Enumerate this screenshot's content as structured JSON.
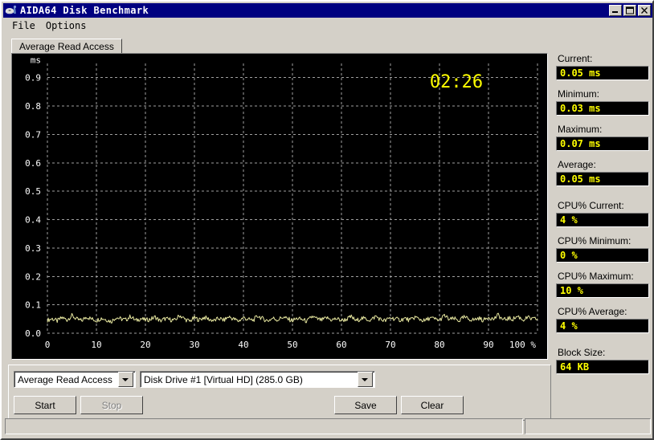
{
  "window": {
    "title": "AIDA64 Disk Benchmark",
    "icon": "disk-icon",
    "buttons": {
      "minimize": "minimize-icon",
      "maximize": "maximize-icon",
      "close": "close-icon"
    }
  },
  "menu": {
    "items": [
      {
        "label": "File"
      },
      {
        "label": "Options"
      }
    ]
  },
  "tab": {
    "label": "Average Read Access"
  },
  "chart_data": {
    "type": "line",
    "title": "",
    "timer": "02:26",
    "xlabel": "%",
    "ylabel": "ms",
    "xlim": [
      0,
      100
    ],
    "ylim": [
      0.0,
      0.95
    ],
    "grid": true,
    "legend": "none",
    "background": "#000000",
    "line_color": "#e8e8a0",
    "grid_color": "#a0a0a0",
    "axis_text_color": "#ffffff",
    "timer_color": "#ffff00",
    "x_ticks": [
      "0",
      "10",
      "20",
      "30",
      "40",
      "50",
      "60",
      "70",
      "80",
      "90",
      "100 %"
    ],
    "x_tick_values": [
      0,
      10,
      20,
      30,
      40,
      50,
      60,
      70,
      80,
      90,
      100
    ],
    "y_ticks": [
      "0.0",
      "0.1",
      "0.2",
      "0.3",
      "0.4",
      "0.5",
      "0.6",
      "0.7",
      "0.8",
      "0.9"
    ],
    "y_tick_values": [
      0.0,
      0.1,
      0.2,
      0.3,
      0.4,
      0.5,
      0.6,
      0.7,
      0.8,
      0.9
    ],
    "series": [
      {
        "name": "Average Read Access",
        "x": [
          0,
          1,
          2,
          3,
          4,
          5,
          6,
          7,
          8,
          9,
          10,
          11,
          12,
          13,
          14,
          15,
          16,
          17,
          18,
          19,
          20,
          21,
          22,
          23,
          24,
          25,
          26,
          27,
          28,
          29,
          30,
          31,
          32,
          33,
          34,
          35,
          36,
          37,
          38,
          39,
          40,
          41,
          42,
          43,
          44,
          45,
          46,
          47,
          48,
          49,
          50,
          51,
          52,
          53,
          54,
          55,
          56,
          57,
          58,
          59,
          60,
          61,
          62,
          63,
          64,
          65,
          66,
          67,
          68,
          69,
          70,
          71,
          72,
          73,
          74,
          75,
          76,
          77,
          78,
          79,
          80,
          81,
          82,
          83,
          84,
          85,
          86,
          87,
          88,
          89,
          90,
          91,
          92,
          93,
          94,
          95,
          96,
          97,
          98,
          99,
          100
        ],
        "values": [
          0.046,
          0.051,
          0.043,
          0.055,
          0.047,
          0.062,
          0.049,
          0.044,
          0.058,
          0.05,
          0.045,
          0.053,
          0.048,
          0.041,
          0.056,
          0.05,
          0.047,
          0.06,
          0.044,
          0.052,
          0.046,
          0.049,
          0.057,
          0.043,
          0.051,
          0.048,
          0.045,
          0.063,
          0.05,
          0.042,
          0.054,
          0.047,
          0.056,
          0.049,
          0.044,
          0.052,
          0.046,
          0.058,
          0.05,
          0.043,
          0.055,
          0.048,
          0.046,
          0.061,
          0.05,
          0.044,
          0.053,
          0.047,
          0.057,
          0.05,
          0.045,
          0.052,
          0.048,
          0.042,
          0.059,
          0.05,
          0.046,
          0.054,
          0.047,
          0.051,
          0.045,
          0.049,
          0.058,
          0.043,
          0.053,
          0.05,
          0.046,
          0.06,
          0.048,
          0.044,
          0.055,
          0.05,
          0.047,
          0.052,
          0.045,
          0.057,
          0.049,
          0.043,
          0.054,
          0.05,
          0.046,
          0.062,
          0.048,
          0.051,
          0.044,
          0.056,
          0.05,
          0.047,
          0.053,
          0.045,
          0.058,
          0.049,
          0.064,
          0.046,
          0.052,
          0.05,
          0.06,
          0.047,
          0.055,
          0.049,
          0.051
        ]
      }
    ]
  },
  "stats": [
    {
      "label": "Current:",
      "value": "0.05 ms",
      "name": "current"
    },
    {
      "label": "Minimum:",
      "value": "0.03 ms",
      "name": "minimum"
    },
    {
      "label": "Maximum:",
      "value": "0.07 ms",
      "name": "maximum"
    },
    {
      "label": "Average:",
      "value": "0.05 ms",
      "name": "average"
    },
    {
      "label": "CPU% Current:",
      "value": "4 %",
      "name": "cpu-current"
    },
    {
      "label": "CPU% Minimum:",
      "value": "0 %",
      "name": "cpu-minimum"
    },
    {
      "label": "CPU% Maximum:",
      "value": "10 %",
      "name": "cpu-maximum"
    },
    {
      "label": "CPU% Average:",
      "value": "4 %",
      "name": "cpu-average"
    },
    {
      "label": "Block Size:",
      "value": "64 KB",
      "name": "block-size"
    }
  ],
  "controls": {
    "test_select": "Average Read Access",
    "drive_select": "Disk Drive #1 [Virtual HD]  (285.0 GB)",
    "start_button": "Start",
    "start_accel": "t",
    "stop_button": "Stop",
    "stop_accel": "S",
    "save_button": "Save",
    "save_accel": "S",
    "clear_button": "Clear",
    "clear_accel": "C"
  },
  "statusbar": {
    "left": "",
    "right": ""
  }
}
